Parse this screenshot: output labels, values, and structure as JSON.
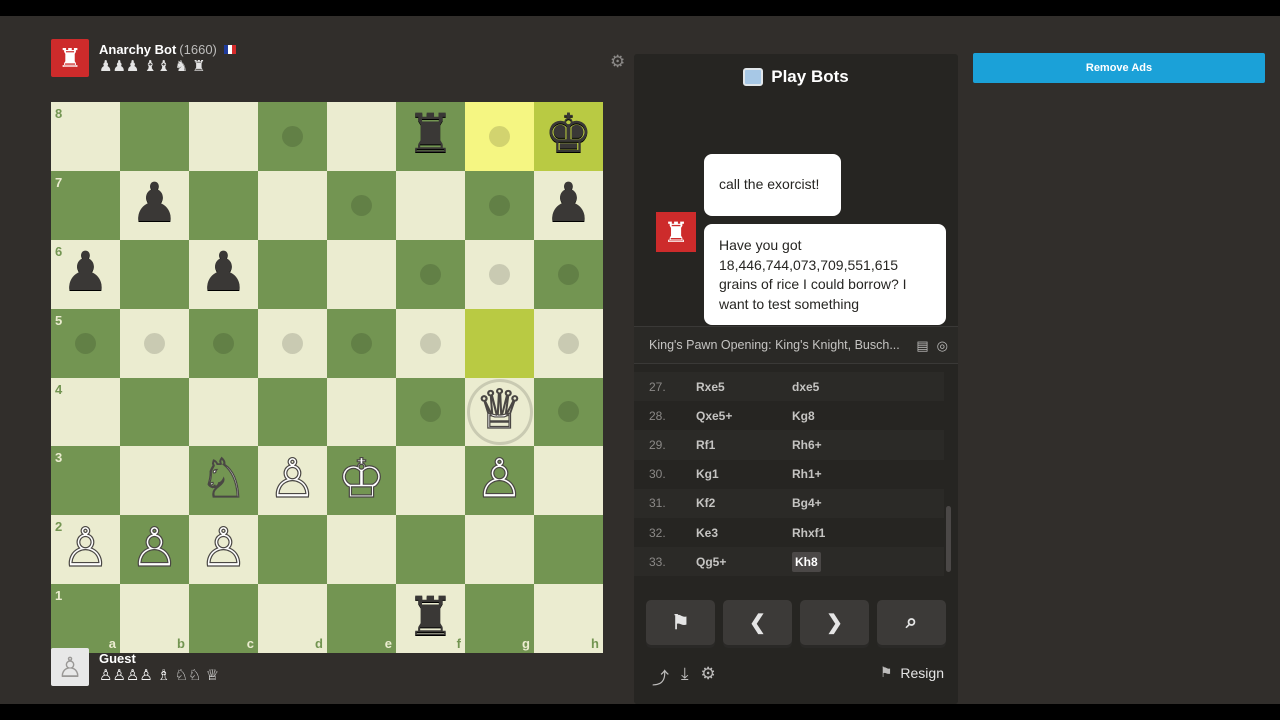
{
  "top_player": {
    "name": "Anarchy Bot",
    "rating": "(1660)",
    "captured": "♟♟♟ ♝♝ ♞ ♜",
    "avatar_glyph": "♜"
  },
  "bottom_player": {
    "name": "Guest",
    "captured": "♙♙♙♙ ♗ ♘♘ ♕",
    "avatar_glyph": "♙"
  },
  "board": {
    "files": [
      "a",
      "b",
      "c",
      "d",
      "e",
      "f",
      "g",
      "h"
    ],
    "ranks": [
      "8",
      "7",
      "6",
      "5",
      "4",
      "3",
      "2",
      "1"
    ],
    "pieces": {
      "f8": {
        "glyph": "♜",
        "color": "b"
      },
      "h8": {
        "glyph": "♚",
        "color": "b"
      },
      "b7": {
        "glyph": "♟",
        "color": "b"
      },
      "h7": {
        "glyph": "♟",
        "color": "b"
      },
      "a6": {
        "glyph": "♟",
        "color": "b"
      },
      "c6": {
        "glyph": "♟",
        "color": "b"
      },
      "g4": {
        "glyph": "♕",
        "color": "w"
      },
      "c3": {
        "glyph": "♘",
        "color": "w"
      },
      "d3": {
        "glyph": "♙",
        "color": "w"
      },
      "e3": {
        "glyph": "♔",
        "color": "w"
      },
      "g3": {
        "glyph": "♙",
        "color": "w"
      },
      "a2": {
        "glyph": "♙",
        "color": "w"
      },
      "b2": {
        "glyph": "♙",
        "color": "w"
      },
      "c2": {
        "glyph": "♙",
        "color": "w"
      },
      "f1": {
        "glyph": "♜",
        "color": "b"
      }
    },
    "highlights": [
      "g8",
      "h8",
      "g5"
    ],
    "move_dots": [
      "d8",
      "g8",
      "e7",
      "g7",
      "f6",
      "g6",
      "h6",
      "a5",
      "b5",
      "c5",
      "d5",
      "e5",
      "f5",
      "h5",
      "f4",
      "h4"
    ],
    "capture_ring": [
      "g4"
    ]
  },
  "panel": {
    "title": "Play Bots",
    "chat": [
      {
        "from": "bot",
        "text": "call the exorcist!"
      },
      {
        "from": "bot",
        "text": "Have you got 18,446,744,073,709,551,615 grains of rice I could borrow? I want to test something"
      }
    ],
    "opening": "King's Pawn Opening: King's Knight, Busch...",
    "moves": [
      {
        "num": "27.",
        "white": "Rxe5",
        "black": "dxe5"
      },
      {
        "num": "28.",
        "white": "Qxe5+",
        "black": "Kg8"
      },
      {
        "num": "29.",
        "white": "Rf1",
        "black": "Rh6+"
      },
      {
        "num": "30.",
        "white": "Kg1",
        "black": "Rh1+"
      },
      {
        "num": "31.",
        "white": "Kf2",
        "black": "Bg4+"
      },
      {
        "num": "32.",
        "white": "Ke3",
        "black": "Rhxf1"
      },
      {
        "num": "33.",
        "white": "Qg5+",
        "black": "Kh8"
      }
    ],
    "current_move": "Kh8",
    "resign_label": "Resign"
  },
  "ads": {
    "label": "Remove Ads"
  },
  "colors": {
    "light": "#ebecd0",
    "dark": "#739552",
    "accent": "#1ba1d8",
    "bot_red": "#cd2b2b"
  }
}
